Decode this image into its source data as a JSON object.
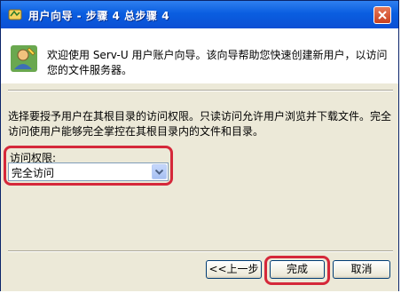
{
  "window": {
    "title": "用户向导 - 步骤 4 总步骤 4",
    "title_icon": "wizard-app-icon",
    "close_icon": "close-icon"
  },
  "header": {
    "icon": "user-wizard-icon",
    "welcome_text": "欢迎使用 Serv-U 用户账户向导。该向导帮助您快速创建新用户，以访问您的文件服务器。"
  },
  "body": {
    "description": "选择要授予用户在其根目录的访问权限。只读访问允许用户浏览并下载文件。完全访问使用户能够完全掌控在其根目录内的文件和目录。",
    "access_label": "访问权限:",
    "access_value": "完全访问"
  },
  "buttons": {
    "back": "<<上一步",
    "finish": "完成",
    "cancel": "取消"
  },
  "colors": {
    "title_bar": "#0a5ee0",
    "highlight_ring": "#d5283a",
    "dialog_bg": "#ece9d8"
  }
}
